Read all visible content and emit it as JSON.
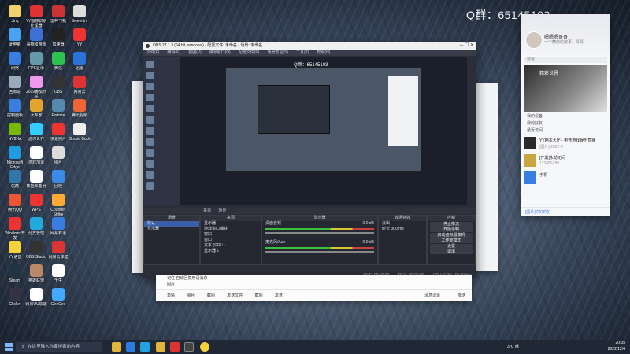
{
  "qq_group_overlay": "Q群：65145103",
  "desktop_icons": [
    {
      "label": "Jing",
      "color": "#f2d16b"
    },
    {
      "label": "YY图標识别处理器",
      "color": "#d33"
    },
    {
      "label": "雷神飞机",
      "color": "#c33"
    },
    {
      "label": "Sweetfim",
      "color": "#ddd"
    },
    {
      "label": "此电脑",
      "color": "#4aa3f0"
    },
    {
      "label": "事物和游戏",
      "color": "#3e6fd6"
    },
    {
      "label": "加速器",
      "color": "#222"
    },
    {
      "label": "YY",
      "color": "#e33"
    },
    {
      "label": "网络",
      "color": "#3a7de0"
    },
    {
      "label": "FPS显示",
      "color": "#69a"
    },
    {
      "label": "微信",
      "color": "#2dc14f"
    },
    {
      "label": "迅雷",
      "color": "#2a74d9"
    },
    {
      "label": "回收站",
      "color": "#9ab"
    },
    {
      "label": "2019番茄作品",
      "color": "#e9e"
    },
    {
      "label": "OBS",
      "color": "#333"
    },
    {
      "label": "网易云",
      "color": "#d33"
    },
    {
      "label": "控制面板",
      "color": "#3a7de0"
    },
    {
      "label": "大专家",
      "color": "#e3a42f"
    },
    {
      "label": "Fortnite",
      "color": "#58a"
    },
    {
      "label": "腾讯视频",
      "color": "#e63"
    },
    {
      "label": "NVIDIA",
      "color": "#76b900"
    },
    {
      "label": "迷你世界",
      "color": "#3cf"
    },
    {
      "label": "快速照片",
      "color": "#e33"
    },
    {
      "label": "Goose Duck",
      "color": "#eee"
    },
    {
      "label": "Microsoft Edge",
      "color": "#1f9be0"
    },
    {
      "label": "游戏加速",
      "color": "#fff"
    },
    {
      "label": "图片",
      "color": "#ddd"
    },
    {
      "label": "优酷",
      "color": "#37a"
    },
    {
      "label": "数据库备份",
      "color": "#fff"
    },
    {
      "label": "回收",
      "color": "#3a8be8"
    },
    {
      "label": "腾讯QQ",
      "color": "#e53"
    },
    {
      "label": "WPS",
      "color": "#e33"
    },
    {
      "label": "Counter-Strike",
      "color": "#fa3"
    },
    {
      "label": "Windows开发",
      "color": "#e33"
    },
    {
      "label": "分支管理",
      "color": "#2ad"
    },
    {
      "label": "网易有道",
      "color": "#3a7de0"
    },
    {
      "label": "YY语音",
      "color": "#f6d23a"
    },
    {
      "label": "OBS Studio",
      "color": "#333"
    },
    {
      "label": "网易云课堂",
      "color": "#d33"
    },
    {
      "label": "Steam",
      "color": "#234"
    },
    {
      "label": "英雄联盟",
      "color": "#b86"
    },
    {
      "label": "千牛",
      "color": "#fff"
    },
    {
      "label": "Clicker",
      "color": "#334"
    },
    {
      "label": "网易UU加速",
      "color": "#fff"
    },
    {
      "label": "GeeGee",
      "color": "#4af"
    }
  ],
  "obs": {
    "window_title": "OBS 27.1.3 (64 bit, windows) - 配置文件: 未命名 - 场景: 未命名",
    "menu": [
      "文件(F)",
      "编辑(E)",
      "视图(V)",
      "停靠窗口(D)",
      "配置文件(P)",
      "场景集合(S)",
      "工具(T)",
      "帮助(H)"
    ],
    "preview_overlay": "Q群：65145103",
    "tabs": [
      "来源",
      "场景"
    ],
    "scenes": {
      "header": "场景",
      "items": [
        "默认",
        "显示器"
      ]
    },
    "sources": {
      "header": "来源",
      "items": [
        "显示器",
        "游戏窗口捕获",
        "窗口",
        "窗口",
        "文本 (GDI+)",
        "显示器 1"
      ]
    },
    "mixer": {
      "header": "混音器",
      "channels": [
        {
          "name": "桌面音频",
          "level": "0.0 dB"
        },
        {
          "name": "麦克风/Aux",
          "level": "0.0 dB"
        }
      ]
    },
    "transitions": {
      "header": "转场特效",
      "type": "淡出",
      "duration_label": "时长",
      "duration": "300 ms"
    },
    "controls": {
      "header": "控制",
      "buttons": [
        "停止推流",
        "开始录制",
        "启动虚拟摄像机",
        "工作室模式",
        "设置",
        "退出"
      ]
    },
    "status": {
      "live": "LIVE: 00:00:00",
      "rec": "REC: 00:00:00",
      "cpu": "CPU: 0.2%, 60.00 fps"
    }
  },
  "chat_window": {
    "line1": "记住 自动回复用语消息",
    "line2": "图片",
    "toolbar": [
      "表情",
      "图片",
      "截图",
      "发送文件",
      "截图",
      "发送"
    ],
    "right_buttons": [
      "消息记录",
      "发送"
    ]
  },
  "qq_panel": {
    "nickname": "嗯嗯嗯哥哥",
    "signature": "一个悲伤的故事，哥哥",
    "search": "搜索",
    "banner": "精彩世界",
    "groups": [
      "我的设备",
      "我的好友",
      "最近访问"
    ],
    "items": [
      {
        "title": "YY剧本大厅 - 电竞游戏娱乐直播",
        "sub": "[图片] 2022-3"
      },
      {
        "title": "[开黑]永劫无间",
        "sub": "123456789"
      },
      {
        "title": "手机",
        "sub": ""
      }
    ],
    "footer": "[图片]你好你好"
  },
  "taskbar": {
    "search_placeholder": "在这里输入你要搜索的内容",
    "weather": "3°C 晴",
    "time": "20:05",
    "date": "2022/12/4"
  }
}
